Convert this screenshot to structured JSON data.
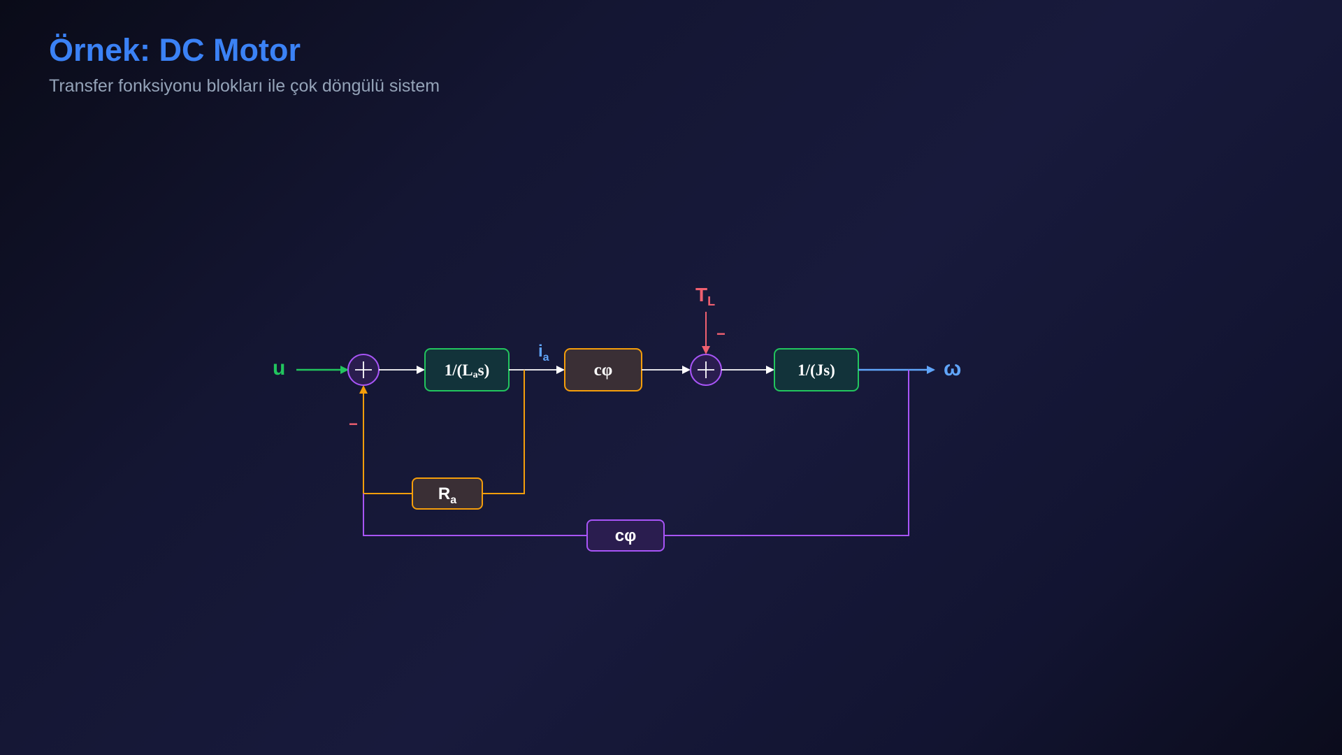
{
  "header": {
    "title": "Örnek: DC Motor",
    "subtitle": "Transfer fonksiyonu blokları ile çok döngülü sistem"
  },
  "diagram": {
    "input_label": "u",
    "output_label": "ω",
    "current_label": {
      "base": "i",
      "sub": "a"
    },
    "disturbance_label": {
      "base": "T",
      "sub": "L"
    },
    "disturbance_sign": "−",
    "feedback_sign": "−",
    "blocks": {
      "inductance": {
        "prefix": "1/(L",
        "sub": "a",
        "suffix": "s)"
      },
      "torque_const": {
        "label": "cφ"
      },
      "inertia": {
        "label": "1/(Js)"
      },
      "resistance": {
        "base": "R",
        "sub": "a"
      },
      "back_emf": {
        "label": "cφ"
      }
    }
  },
  "colors": {
    "title": "#3b82f6",
    "subtitle": "#94a3b8",
    "input": "#22c55e",
    "output": "#60a5fa",
    "disturbance": "#f06070",
    "summer": "#a855f7",
    "resistance_loop": "#f59e0b",
    "emf_loop": "#a855f7",
    "signal": "#ffffff"
  }
}
